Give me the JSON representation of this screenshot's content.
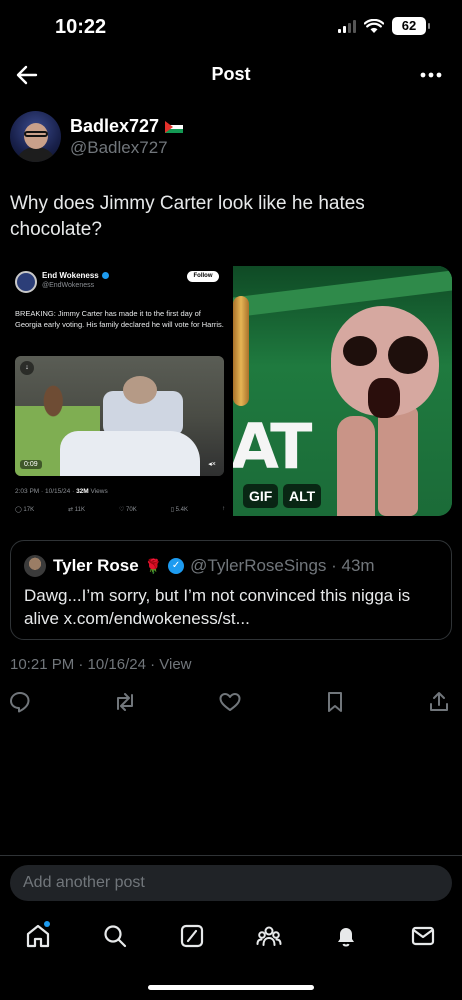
{
  "status": {
    "time": "10:22",
    "battery": "62"
  },
  "header": {
    "title": "Post",
    "back_icon": "arrow-left-icon",
    "more_icon": "more-icon"
  },
  "author": {
    "display_name": "Badlex727",
    "handle": "@Badlex727"
  },
  "post": {
    "text": "Why does Jimmy Carter look like he hates chocolate?"
  },
  "media": {
    "screenshot": {
      "name": "End Wokeness",
      "handle": "@EndWokeness",
      "follow": "Follow",
      "text": "BREAKING: Jimmy Carter has made it to the first day of Georgia early voting. His family declared he will vote for Harris.",
      "video_time": "0:09",
      "meta_date": "2:03 PM · 10/15/24 · ",
      "meta_views": "32M",
      "meta_views_label": " Views",
      "replies": "17K",
      "reposts": "11K",
      "likes": "70K",
      "bookmarks": "5.4K"
    },
    "gif_badge": "GIF",
    "alt_badge": "ALT"
  },
  "quote": {
    "name": "Tyler Rose",
    "emoji": "🌹",
    "handle": "@TylerRoseSings · 43m",
    "text": "Dawg...I’m sorry, but I’m not convinced this nigga is alive x.com/endwokeness/st..."
  },
  "timestamp": "10:21 PM · 10/16/24 · View",
  "actions": [
    "reply-icon",
    "repost-icon",
    "like-icon",
    "bookmark-icon",
    "share-icon"
  ],
  "reply": {
    "placeholder": "Add another post"
  },
  "tabs": [
    "home-icon",
    "search-icon",
    "grok-icon",
    "communities-icon",
    "notifications-icon",
    "messages-icon"
  ],
  "colors": {
    "accent": "#1d9bf0",
    "secondary_text": "#71767b",
    "border": "#2f3336"
  }
}
